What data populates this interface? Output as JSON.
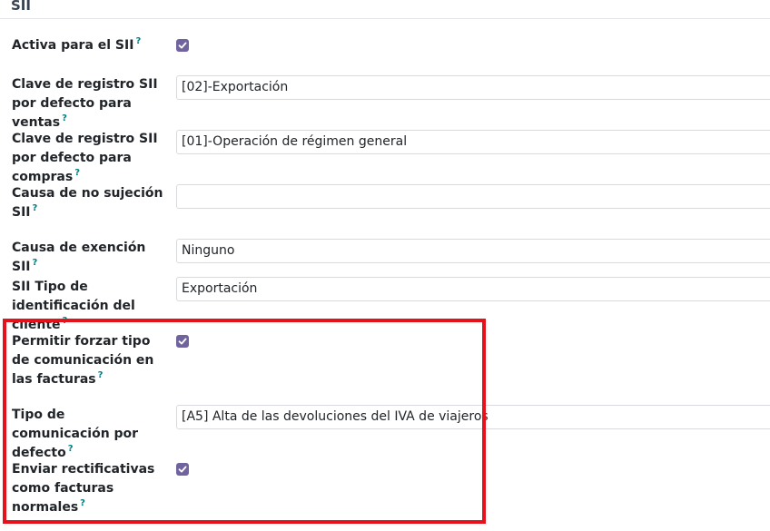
{
  "section": {
    "title": "SII"
  },
  "help_marker": "?",
  "fields": [
    {
      "label": "Activa para el SII",
      "type": "checkbox",
      "checked": true
    },
    {
      "label": "Clave de registro SII por defecto para ventas",
      "type": "select",
      "value": "[02]-Exportación"
    },
    {
      "label": "Clave de registro SII por defecto para compras",
      "type": "select",
      "value": "[01]-Operación de régimen general"
    },
    {
      "label": "Causa de no sujeción SII",
      "type": "select",
      "value": ""
    },
    {
      "label": "Causa de exención SII",
      "type": "select",
      "value": "Ninguno"
    },
    {
      "label": "SII Tipo de identificación del cliente",
      "type": "select",
      "value": "Exportación"
    },
    {
      "label": "Permitir forzar tipo de comunicación en las facturas",
      "type": "checkbox",
      "checked": true
    },
    {
      "label": "Tipo de comunicación por defecto",
      "type": "select",
      "value": "[A5] Alta de las devoluciones del IVA de viajeros"
    },
    {
      "label": "Enviar rectificativas como facturas normales",
      "type": "checkbox",
      "checked": true
    }
  ],
  "colors": {
    "checkbox": "#71639e",
    "help": "#017e84",
    "highlight_border": "#e6121b"
  }
}
